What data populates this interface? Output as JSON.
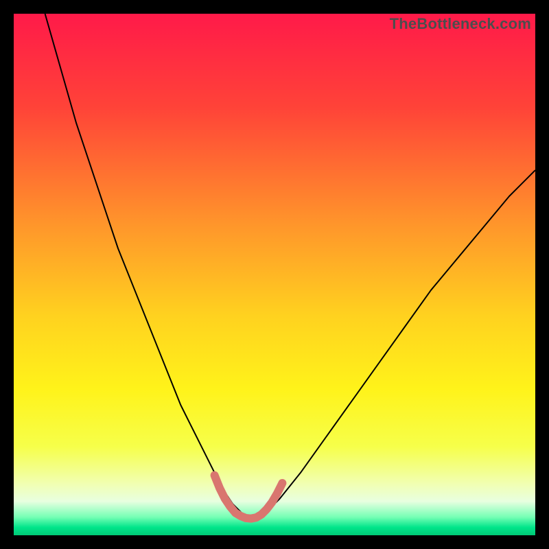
{
  "watermark": "TheBottleneck.com",
  "chart_data": {
    "type": "line",
    "title": "",
    "xlabel": "",
    "ylabel": "",
    "xlim": [
      0,
      100
    ],
    "ylim": [
      0,
      100
    ],
    "grid": false,
    "legend": false,
    "gradient_stops": [
      {
        "offset": 0.0,
        "color": "#ff1a49"
      },
      {
        "offset": 0.18,
        "color": "#ff4338"
      },
      {
        "offset": 0.4,
        "color": "#ff942b"
      },
      {
        "offset": 0.58,
        "color": "#ffd21f"
      },
      {
        "offset": 0.72,
        "color": "#fff31a"
      },
      {
        "offset": 0.83,
        "color": "#f6ff4a"
      },
      {
        "offset": 0.9,
        "color": "#f1ffb0"
      },
      {
        "offset": 0.935,
        "color": "#e8ffe0"
      },
      {
        "offset": 0.965,
        "color": "#76ffb5"
      },
      {
        "offset": 0.985,
        "color": "#00e58a"
      },
      {
        "offset": 1.0,
        "color": "#00c976"
      }
    ],
    "series": [
      {
        "name": "bottleneck-curve",
        "color": "#000000",
        "width": 2,
        "x": [
          6,
          8,
          10,
          12,
          14,
          16,
          18,
          20,
          22,
          24,
          26,
          28,
          30,
          32,
          34,
          36,
          38,
          40,
          42,
          44,
          46,
          48,
          51,
          55,
          60,
          65,
          70,
          75,
          80,
          85,
          90,
          95,
          100
        ],
        "y": [
          100,
          93,
          86,
          79,
          73,
          67,
          61,
          55,
          50,
          45,
          40,
          35,
          30,
          25,
          21,
          17,
          13,
          9,
          6,
          4,
          3,
          4,
          7,
          12,
          19,
          26,
          33,
          40,
          47,
          53,
          59,
          65,
          70
        ]
      },
      {
        "name": "optimal-zone-highlight",
        "color": "#d9766f",
        "width": 12,
        "linecap": "round",
        "x": [
          38.5,
          39.5,
          40.5,
          41.5,
          42.5,
          43.5,
          44.5,
          45.5,
          46.5,
          47.5,
          48.5,
          49.5,
          50.5,
          51.5
        ],
        "y": [
          11.5,
          9.0,
          7.0,
          5.5,
          4.3,
          3.7,
          3.3,
          3.2,
          3.4,
          4.0,
          5.0,
          6.3,
          8.0,
          10.0
        ]
      }
    ]
  }
}
